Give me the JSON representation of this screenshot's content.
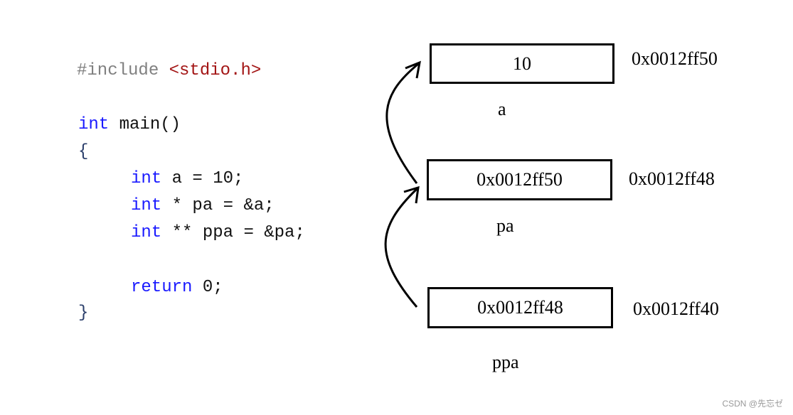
{
  "code": {
    "include_directive": "#include",
    "include_header": "<stdio.h>",
    "main_type": "int",
    "main_sig": " main()",
    "open_brace": "{",
    "line_a": {
      "type": "int",
      "rest": " a = 10;"
    },
    "line_pa": {
      "type": "int",
      "rest": " * pa = &a;"
    },
    "line_ppa": {
      "type": "int",
      "rest": " ** ppa = &pa;"
    },
    "return_kw": "return",
    "return_rest": " 0;",
    "close_brace": "}"
  },
  "memory": [
    {
      "value": "10",
      "name": "a",
      "address": "0x0012ff50"
    },
    {
      "value": "0x0012ff50",
      "name": "pa",
      "address": "0x0012ff48"
    },
    {
      "value": "0x0012ff48",
      "name": "ppa",
      "address": "0x0012ff40"
    }
  ],
  "watermark": "CSDN @先忘ゼ"
}
